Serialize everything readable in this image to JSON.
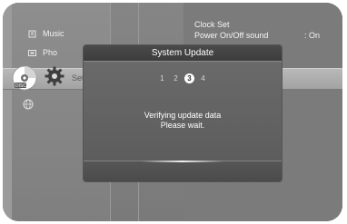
{
  "menu": {
    "items": [
      {
        "label": "Music",
        "icon": "music-icon"
      },
      {
        "label": "Pho",
        "icon": "photo-icon"
      },
      {
        "label": "Set",
        "icon": "gear-icon"
      }
    ],
    "disc_icon": "disc-icon",
    "network_icon": "globe-icon"
  },
  "settings": {
    "clock_label": "Clock Set",
    "power_label": "Power On/Off sound",
    "power_value": ": On"
  },
  "dialog": {
    "title": "System Update",
    "steps": [
      "1",
      "2",
      "3",
      "4"
    ],
    "active_step": "3",
    "message_line1": "Verifying update data",
    "message_line2": "Please wait."
  },
  "colors": {
    "panel": "#7b7b7b",
    "dialog_bg": "#5e5e5e",
    "title_bar": "#404040",
    "text": "#ffffff"
  }
}
